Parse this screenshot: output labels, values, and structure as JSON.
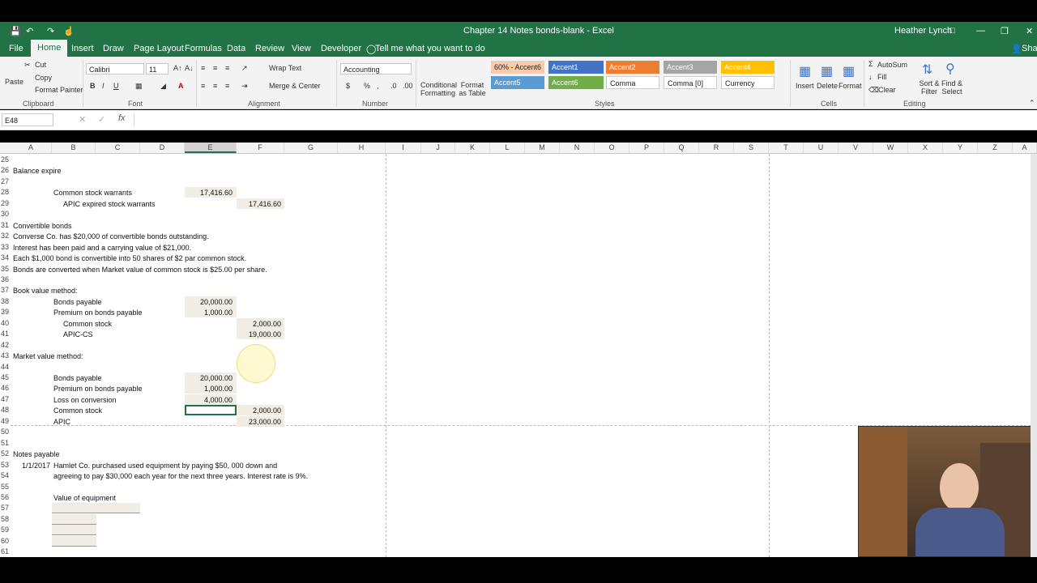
{
  "window": {
    "title": "Chapter 14 Notes bonds-blank - Excel",
    "user": "Heather Lynch",
    "share_label": "Share"
  },
  "tabs": [
    "File",
    "Home",
    "Insert",
    "Draw",
    "Page Layout",
    "Formulas",
    "Data",
    "Review",
    "View",
    "Developer"
  ],
  "tell_me": "Tell me what you want to do",
  "ribbon": {
    "clipboard": {
      "paste": "Paste",
      "cut": "Cut",
      "copy": "Copy",
      "format_painter": "Format Painter",
      "label": "Clipboard"
    },
    "font": {
      "name": "Calibri",
      "size": "11",
      "label": "Font"
    },
    "alignment": {
      "wrap": "Wrap Text",
      "merge": "Merge & Center",
      "label": "Alignment"
    },
    "number": {
      "format": "Accounting",
      "label": "Number"
    },
    "styles": {
      "conditional": "Conditional Formatting",
      "format_as_table": "Format as Table",
      "boxes": [
        {
          "text": "60% - Accent6",
          "color": "#f8cbad"
        },
        {
          "text": "Accent1",
          "color": "#4472c4"
        },
        {
          "text": "Accent2",
          "color": "#ed7d31"
        },
        {
          "text": "Accent3",
          "color": "#a5a5a5"
        },
        {
          "text": "Accent4",
          "color": "#ffc000"
        },
        {
          "text": "Accent5",
          "color": "#5b9bd5"
        },
        {
          "text": "Accent6",
          "color": "#70ad47"
        },
        {
          "text": "Comma",
          "color": "#ffffff"
        },
        {
          "text": "Comma [0]",
          "color": "#ffffff"
        },
        {
          "text": "Currency",
          "color": "#ffffff"
        }
      ],
      "label": "Styles"
    },
    "cells": {
      "insert": "Insert",
      "delete": "Delete",
      "format": "Format",
      "label": "Cells"
    },
    "editing": {
      "autosum": "AutoSum",
      "fill": "Fill",
      "clear": "Clear",
      "sort": "Sort & Filter",
      "find": "Find & Select",
      "label": "Editing"
    }
  },
  "formula_bar": {
    "name_box": "E48",
    "content": ""
  },
  "columns": [
    "A",
    "B",
    "C",
    "D",
    "E",
    "F",
    "G",
    "H",
    "I",
    "J",
    "K",
    "L",
    "M",
    "N",
    "O",
    "P",
    "Q",
    "R",
    "S",
    "T",
    "U",
    "V",
    "W",
    "X",
    "Y",
    "Z",
    "A"
  ],
  "rows": [
    "25",
    "26",
    "27",
    "28",
    "29",
    "30",
    "31",
    "32",
    "33",
    "34",
    "35",
    "36",
    "37",
    "38",
    "39",
    "40",
    "41",
    "42",
    "43",
    "44",
    "45",
    "46",
    "47",
    "48",
    "49",
    "50",
    "51",
    "52",
    "53",
    "54",
    "55",
    "56",
    "57",
    "58",
    "59",
    "60",
    "61"
  ],
  "sheet": {
    "r26a": "Balance expire",
    "r28b": "Common stock warrants",
    "r28e": "17,416.60",
    "r29b": "APIC expired stock warrants",
    "r29f": "17,416.60",
    "r31a": "Convertible bonds",
    "r32a": "Converse Co. has $20,000 of convertible bonds outstanding.",
    "r33a": "Interest has been paid and a carrying value of $21,000.",
    "r34a": "Each $1,000 bond is convertible into 50 shares of $2 par common stock.",
    "r35a": "Bonds are converted when Market value of common stock is $25.00 per share.",
    "r37a": "Book value method:",
    "r38b": "Bonds payable",
    "r38e": "20,000.00",
    "r39b": "Premium on bonds payable",
    "r39e": "1,000.00",
    "r40b": "Common stock",
    "r40f": "2,000.00",
    "r41b": "APIC-CS",
    "r41f": "19,000.00",
    "r43a": "Market value method:",
    "r45b": "Bonds payable",
    "r45e": "20,000.00",
    "r46b": "Premium on bonds payable",
    "r46e": "1,000.00",
    "r47b": "Loss on conversion",
    "r47e": "4,000.00",
    "r48b": "Common stock",
    "r48f": "2,000.00",
    "r49b": "APIC",
    "r49f": "23,000.00",
    "r52a": "Notes payable",
    "r53a": "1/1/2017",
    "r53b": "Hamlet Co. purchased used equipment by paying $50, 000 down and",
    "r54b": "agreeing to pay $30,000 each year for the next three years. Interest rate is 9%.",
    "r56b": "Value of equipment"
  }
}
